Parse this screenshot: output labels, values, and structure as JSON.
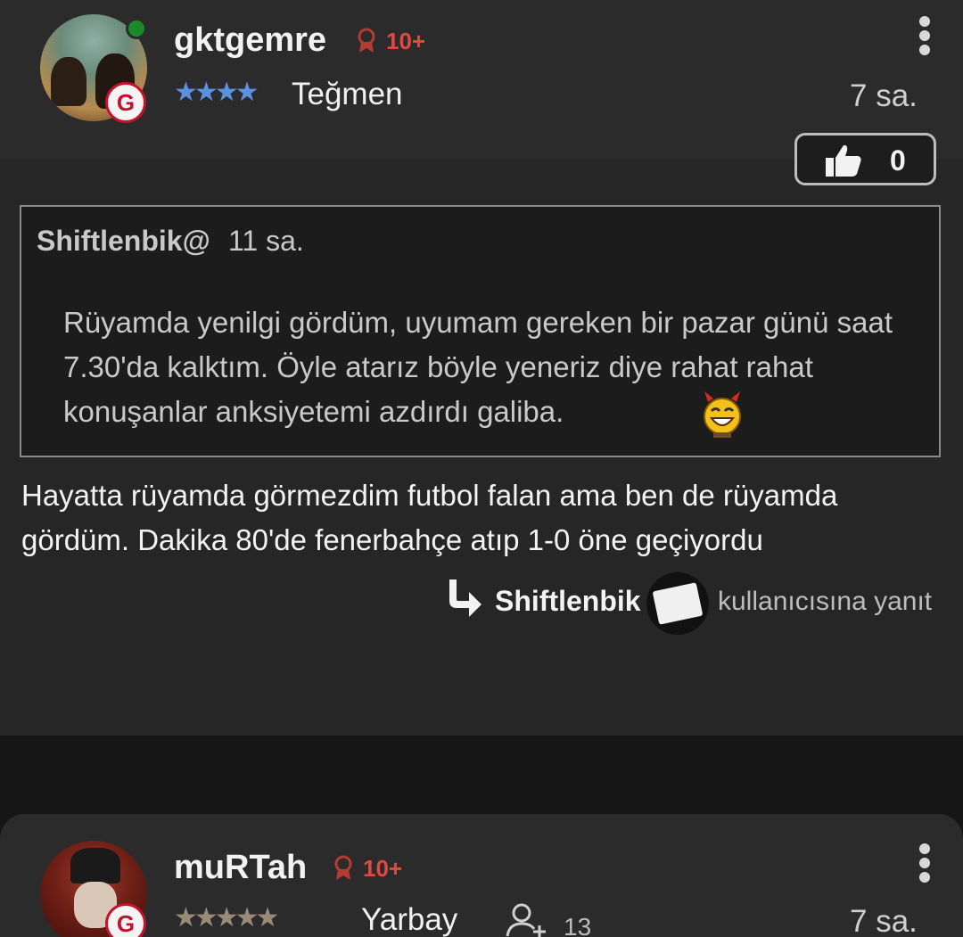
{
  "comments": [
    {
      "username": "gktgemre",
      "rank_count": "10+",
      "rank_title": "Teğmen",
      "stars": "★★★★",
      "star_color": "#5b8fe0",
      "time": "7 sa.",
      "likes": "0",
      "team_badge": "G",
      "online": true,
      "quote": {
        "author": "Shiftlenbik@",
        "time": "11 sa.",
        "text": "Rüyamda yenilgi gördüm, uyumam gereken bir pazar günü saat 7.30'da kalktım. Öyle atarız böyle yeneriz diye rahat rahat konuşanlar anksiyetemi azdırdı galiba."
      },
      "body": "Hayatta rüyamda görmezdim futbol falan ama ben de rüyamda gördüm. Dakika 80'de fenerbahçe atıp 1-0 öne geçiyordu",
      "reply": {
        "to": "Shiftlenbik",
        "suffix": "kullanıcısına yanıt"
      }
    },
    {
      "username": "muRTah",
      "rank_count": "10+",
      "rank_title": "Yarbay",
      "stars": "★★★★★",
      "star_color": "#9a8a78",
      "time": "7 sa.",
      "friend_count": "13",
      "team_badge": "G"
    }
  ],
  "colors": {
    "accent_red": "#e0493e",
    "galatasaray_red": "#c4122e",
    "online_green": "#1a8a2a"
  },
  "icons": [
    "ribbon-icon",
    "kebab-menu-icon",
    "thumbs-up-icon",
    "reply-arrow-icon",
    "add-friend-icon",
    "laughing-devil-emoji"
  ]
}
